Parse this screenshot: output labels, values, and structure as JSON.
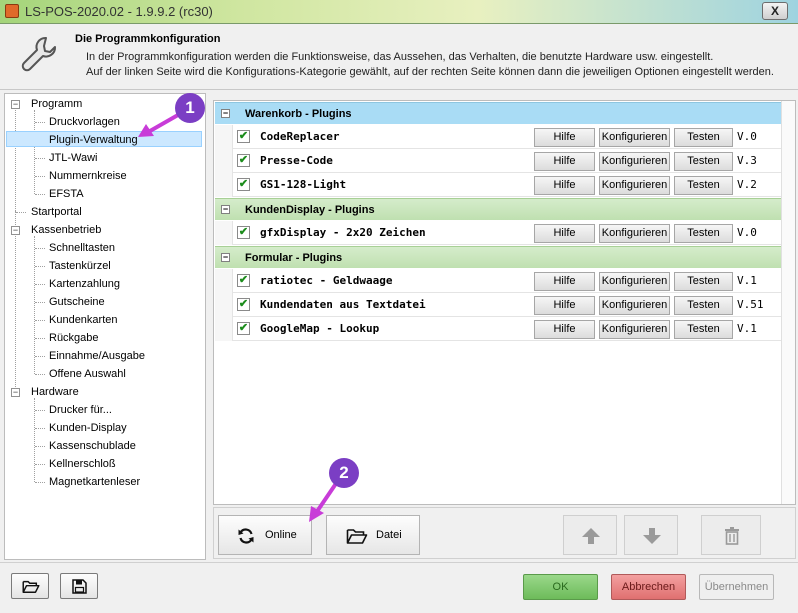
{
  "window": {
    "title": "LS-POS-2020.02 - 1.9.9.2 (rc30)",
    "close_label": "X"
  },
  "header": {
    "title": "Die Programmkonfiguration",
    "line1": "In der Programmkonfiguration werden die Funktionsweise, das Aussehen, das Verhalten, die benutzte Hardware usw. eingestellt.",
    "line2": "Auf der linken Seite wird die Konfigurations-Kategorie gewählt, auf der rechten Seite können dann die jeweiligen Optionen eingestellt werden."
  },
  "tree": {
    "programm": "Programm",
    "druckvorlagen": "Druckvorlagen",
    "plugin_verwaltung": "Plugin-Verwaltung",
    "jtl_wawi": "JTL-Wawi",
    "nummernkreise": "Nummernkreise",
    "efsta": "EFSTA",
    "startportal": "Startportal",
    "kassenbetrieb": "Kassenbetrieb",
    "schnelltasten": "Schnelltasten",
    "tastenkuerzel": "Tastenkürzel",
    "kartenzahlung": "Kartenzahlung",
    "gutscheine": "Gutscheine",
    "kundenkarten": "Kundenkarten",
    "rueckgabe": "Rückgabe",
    "einnahme_ausgabe": "Einnahme/Ausgabe",
    "offene_auswahl": "Offene Auswahl",
    "hardware": "Hardware",
    "drucker": "Drucker für...",
    "kunden_display": "Kunden-Display",
    "kassenschublade": "Kassenschublade",
    "kellnerschloss": "Kellnerschloß",
    "magnetkartenleser": "Magnetkartenleser"
  },
  "buttons": {
    "hilfe": "Hilfe",
    "konfigurieren": "Konfigurieren",
    "testen": "Testen"
  },
  "groups": [
    {
      "label": "Warenkorb - Plugins",
      "toggle": "⊟",
      "plugins": [
        {
          "name": "CodeReplacer",
          "version": "V.0"
        },
        {
          "name": "Presse-Code",
          "version": "V.3"
        },
        {
          "name": "GS1-128-Light",
          "version": "V.2"
        }
      ]
    },
    {
      "label": "KundenDisplay - Plugins",
      "toggle": "⊟",
      "plugins": [
        {
          "name": "gfxDisplay - 2x20 Zeichen",
          "version": "V.0"
        }
      ]
    },
    {
      "label": "Formular - Plugins",
      "toggle": "⊟",
      "plugins": [
        {
          "name": "ratiotec - Geldwaage",
          "version": "V.1"
        },
        {
          "name": "Kundendaten aus Textdatei",
          "version": "V.51"
        },
        {
          "name": "GoogleMap - Lookup",
          "version": "V.1"
        }
      ]
    }
  ],
  "bottom": {
    "online": "Online",
    "datei": "Datei"
  },
  "footer": {
    "ok": "OK",
    "abbrechen": "Abbrechen",
    "uebernehmen": "Übernehmen"
  },
  "markers": {
    "m1": "1",
    "m2": "2"
  },
  "colors": {
    "accent_arrow": "#c83cd8",
    "marker_bg": "#7b3ec4",
    "group_blue": "#a9dcf5",
    "group_green": "#c9e6bd",
    "ok_green": "#7cc66a",
    "cancel_red": "#e88080"
  }
}
